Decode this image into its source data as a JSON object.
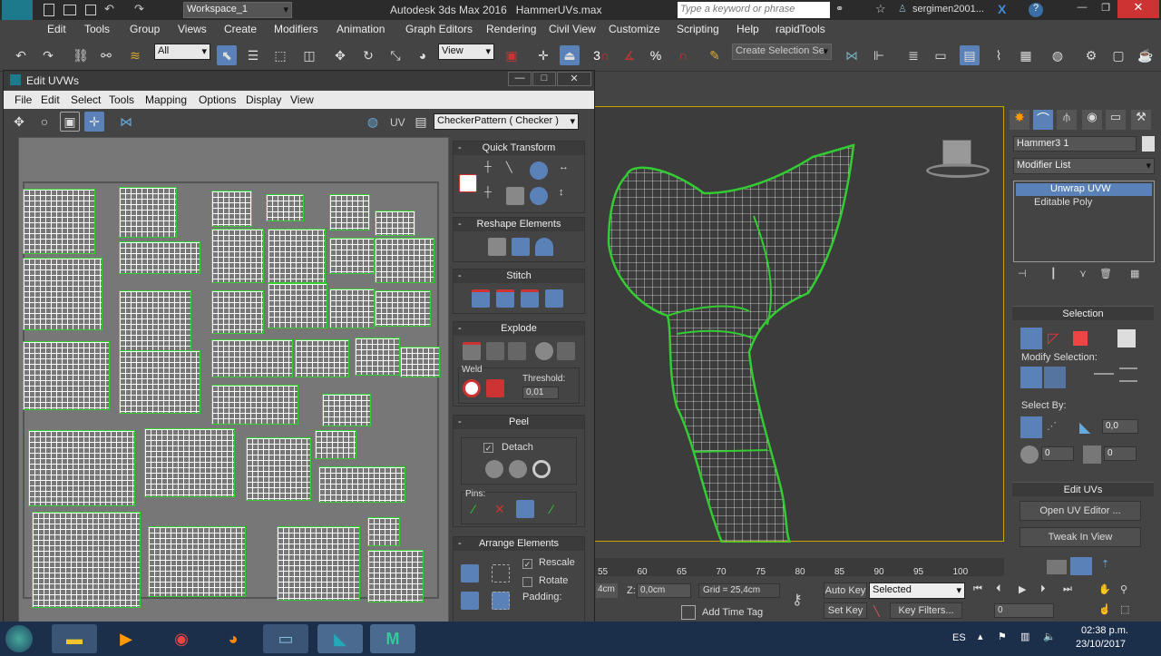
{
  "app": {
    "title": "Autodesk 3ds Max 2016",
    "file": "HammerUVs.max",
    "workspace": "Workspace_1",
    "search_placeholder": "Type a keyword or phrase",
    "user": "sergimen2001...",
    "logo": "MAX"
  },
  "menu": [
    "Edit",
    "Tools",
    "Group",
    "Views",
    "Create",
    "Modifiers",
    "Animation",
    "Graph Editors",
    "Rendering",
    "Civil View",
    "Customize",
    "Scripting",
    "Help",
    "rapidTools"
  ],
  "toolbar": {
    "filter": "All",
    "refcoord": "View",
    "selection_set": "Create Selection Se"
  },
  "uvw": {
    "title": "Edit UVWs",
    "menu": [
      "File",
      "Edit",
      "Select",
      "Tools",
      "Mapping",
      "Options",
      "Display",
      "View"
    ],
    "uv_label": "UV",
    "texture": "CheckerPattern  ( Checker )",
    "panels": {
      "quick_transform": "Quick Transform",
      "reshape": "Reshape Elements",
      "stitch": "Stitch",
      "explode": "Explode",
      "weld": "Weld",
      "threshold_label": "Threshold:",
      "threshold_value": "0,01",
      "peel": "Peel",
      "detach": "Detach",
      "pins": "Pins:",
      "arrange": "Arrange Elements",
      "rescale": "Rescale",
      "rotate": "Rotate",
      "padding": "Padding:"
    }
  },
  "cmdpanel": {
    "object_name": "Hammer3 1",
    "modifier_list": "Modifier List",
    "stack": [
      "Unwrap UVW",
      "Editable Poly"
    ],
    "selection_head": "Selection",
    "modify_selection": "Modify Selection:",
    "select_by": "Select By:",
    "angle_value": "0,0",
    "spin1": "0",
    "spin2": "0",
    "edit_uvs": "Edit UVs",
    "open_uv_editor": "Open UV Editor ...",
    "tweak_in_view": "Tweak In View"
  },
  "timeline": {
    "ticks": [
      "55",
      "60",
      "65",
      "70",
      "75",
      "80",
      "85",
      "90",
      "95",
      "100"
    ]
  },
  "status": {
    "x_label": "4cm",
    "z_label": "Z:",
    "z_value": "0,0cm",
    "grid": "Grid = 25,4cm",
    "add_time_tag": "Add Time Tag",
    "auto_key": "Auto Key",
    "set_key": "Set Key",
    "key_mode": "Selected",
    "key_filters": "Key Filters...",
    "frame": "0"
  },
  "taskbar": {
    "lang": "ES",
    "time": "02:38 p.m.",
    "date": "23/10/2017"
  },
  "colors": {
    "accent": "#5a82b8",
    "uv_seam": "#33cc33",
    "viewport_border": "#c8a000"
  }
}
